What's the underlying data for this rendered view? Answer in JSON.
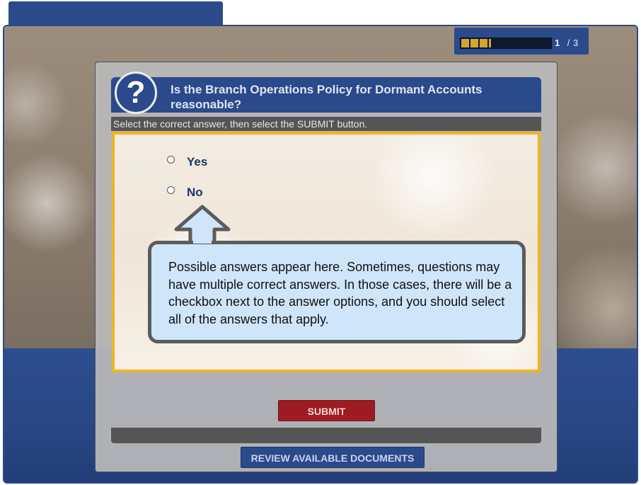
{
  "progress": {
    "current": "1",
    "total": "/ 3",
    "fraction": 0.33
  },
  "question": {
    "icon": "question-mark-icon",
    "icon_glyph": "?",
    "text": "Is the Branch Operations Policy for Dormant Accounts reasonable?",
    "instruction": "Select the correct answer, then select the SUBMIT button."
  },
  "options": [
    {
      "label": "Yes",
      "selected": false
    },
    {
      "label": "No",
      "selected": false
    }
  ],
  "callout": {
    "text": "Possible answers appear here. Sometimes, questions may have multiple correct answers. In those cases, there will be a checkbox next to the answer options, and you should select all of the answers that apply."
  },
  "buttons": {
    "submit": "SUBMIT",
    "review": "REVIEW AVAILABLE DOCUMENTS"
  },
  "colors": {
    "brand_blue": "#2b4a8b",
    "highlight": "#f0b325",
    "submit_red": "#9e1b22",
    "callout_bg": "#cfe5fa"
  }
}
